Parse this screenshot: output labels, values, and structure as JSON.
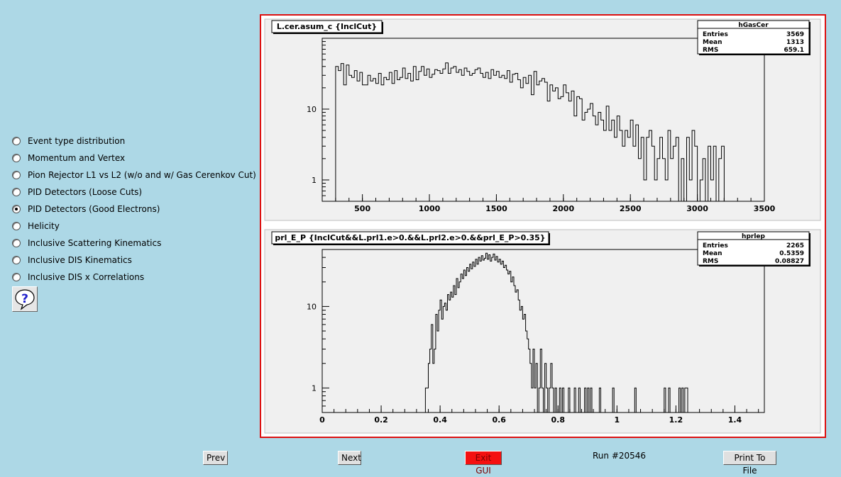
{
  "menu": {
    "items": [
      {
        "label": "Event type distribution",
        "checked": false
      },
      {
        "label": "Momentum and Vertex",
        "checked": false
      },
      {
        "label": "Pion Rejector L1 vs L2 (w/o and w/ Gas Cerenkov Cut)",
        "checked": false
      },
      {
        "label": "PID Detectors (Loose Cuts)",
        "checked": false
      },
      {
        "label": "PID Detectors (Good Electrons)",
        "checked": true
      },
      {
        "label": "Helicity",
        "checked": false
      },
      {
        "label": "Inclusive Scattering Kinematics",
        "checked": false
      },
      {
        "label": "Inclusive DIS Kinematics",
        "checked": false
      },
      {
        "label": "Inclusive DIS x Correlations",
        "checked": false
      }
    ]
  },
  "help": {
    "icon": "question-mark-icon"
  },
  "buttons": {
    "prev": "Prev",
    "next": "Next",
    "exit": "Exit GUI",
    "print": "Print To File"
  },
  "run_label": "Run #20546",
  "colors": {
    "background": "#add8e6",
    "frame": "#dd1111",
    "exit_button": "#f41010"
  },
  "chart_data": [
    {
      "type": "histogram",
      "title": "L.cer.asum_c {InclCut}",
      "stats": {
        "name": "hGasCer",
        "Entries": "3569",
        "Mean": "1313",
        "RMS": "659.1"
      },
      "xlim": [
        200,
        3500
      ],
      "xticks": [
        "500",
        "1000",
        "1500",
        "2000",
        "2500",
        "3000",
        "3500"
      ],
      "yscale": "log",
      "ylim": [
        0.5,
        100
      ],
      "yticks": [
        "1",
        "10"
      ],
      "bin_start": 300,
      "bin_width": 20,
      "values": [
        40,
        35,
        44,
        22,
        42,
        30,
        28,
        35,
        25,
        33,
        22,
        22,
        30,
        25,
        27,
        23,
        32,
        22,
        28,
        26,
        33,
        23,
        35,
        26,
        28,
        38,
        27,
        32,
        25,
        40,
        26,
        34,
        40,
        30,
        37,
        28,
        31,
        36,
        35,
        32,
        37,
        45,
        32,
        38,
        40,
        33,
        36,
        30,
        38,
        34,
        30,
        32,
        36,
        38,
        32,
        28,
        33,
        27,
        36,
        30,
        34,
        28,
        30,
        27,
        35,
        24,
        31,
        32,
        26,
        20,
        28,
        23,
        30,
        16,
        34,
        22,
        25,
        27,
        24,
        13,
        22,
        18,
        20,
        14,
        15,
        22,
        17,
        13,
        18,
        8,
        15,
        14,
        7,
        9,
        10,
        12,
        8,
        6,
        9,
        7,
        5,
        11,
        5,
        7,
        4,
        8,
        5,
        3,
        5,
        4,
        7,
        3,
        6,
        2,
        4,
        1,
        4,
        5,
        3,
        1,
        2,
        4,
        2,
        1,
        5,
        2,
        3,
        4,
        0,
        2,
        0,
        4,
        1,
        5,
        3,
        0,
        1,
        2,
        0,
        3,
        1,
        3,
        0,
        2,
        3,
        0
      ]
    },
    {
      "type": "histogram",
      "title": "prl_E_P {InclCut&&L.prl1.e>0.&&L.prl2.e>0.&&prl_E_P>0.35}",
      "stats": {
        "name": "hprlep",
        "Entries": "2265",
        "Mean": "0.5359",
        "RMS": "0.08827"
      },
      "xlim": [
        0,
        1.5
      ],
      "xticks": [
        "0",
        "0.2",
        "0.4",
        "0.6",
        "0.8",
        "1",
        "1.2",
        "1.4"
      ],
      "yscale": "log",
      "ylim": [
        0.5,
        50
      ],
      "yticks": [
        "1",
        "10"
      ],
      "bin_start": 0.35,
      "bin_width": 0.005,
      "values": [
        1,
        1,
        2,
        3,
        6,
        2,
        3,
        8,
        5,
        9,
        12,
        7,
        10,
        11,
        9,
        14,
        12,
        15,
        13,
        18,
        14,
        22,
        17,
        20,
        25,
        22,
        28,
        24,
        30,
        27,
        33,
        29,
        35,
        31,
        38,
        33,
        40,
        36,
        42,
        37,
        39,
        45,
        38,
        43,
        36,
        40,
        44,
        37,
        41,
        35,
        38,
        33,
        36,
        30,
        32,
        28,
        25,
        27,
        20,
        23,
        18,
        15,
        16,
        12,
        9,
        10,
        7,
        8,
        5,
        4,
        3,
        2,
        1,
        3,
        1,
        2,
        0,
        1,
        3,
        1,
        0,
        2,
        1,
        0,
        1,
        2,
        1,
        0,
        1,
        0,
        0,
        1,
        0,
        1,
        0,
        0,
        0,
        1,
        0,
        0,
        0,
        1,
        0,
        0,
        1,
        0,
        0,
        0,
        1,
        0,
        1,
        0,
        1,
        0,
        0,
        0,
        0,
        0,
        1,
        0,
        0,
        0,
        0,
        0,
        0,
        0,
        0,
        1,
        0,
        0,
        0,
        0,
        0,
        0,
        0,
        0,
        0,
        0,
        0,
        0,
        0,
        0,
        1,
        0,
        0,
        0,
        0,
        0,
        0,
        0,
        0,
        0,
        0,
        0,
        0,
        0,
        0,
        0,
        0,
        0,
        0,
        0,
        1,
        0,
        0,
        1,
        0,
        0,
        0,
        0,
        0,
        0,
        1,
        0,
        1,
        0,
        1,
        1,
        0,
        0,
        0,
        0,
        0,
        0,
        0,
        0,
        0,
        0,
        0,
        0,
        0,
        0,
        0,
        0
      ]
    }
  ]
}
